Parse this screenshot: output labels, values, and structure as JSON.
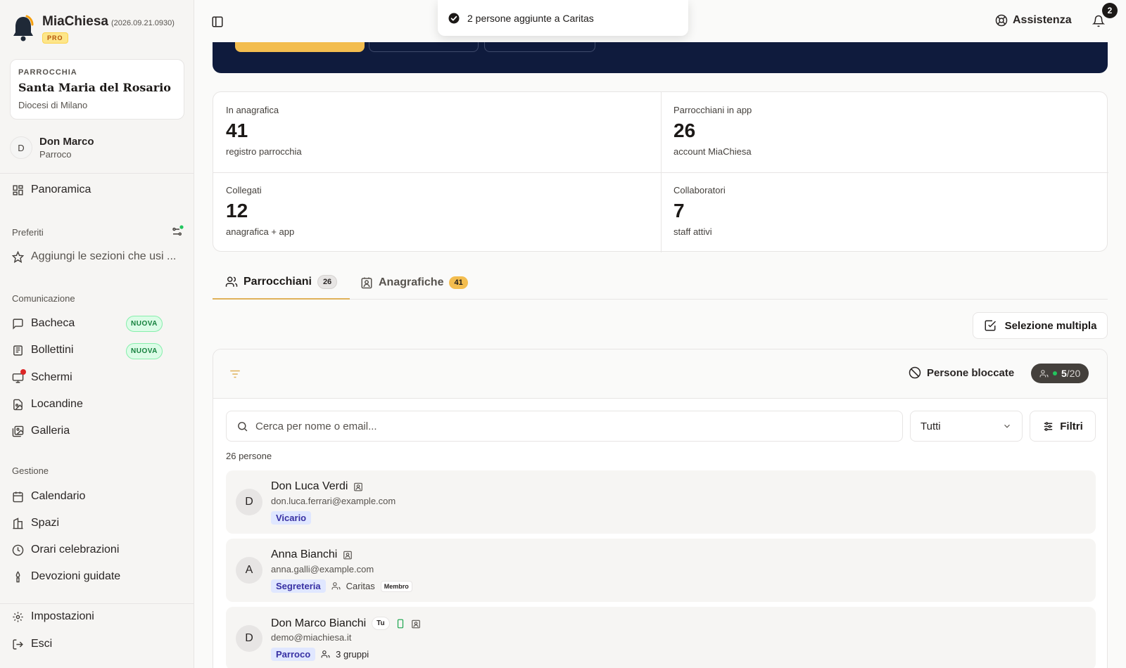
{
  "app": {
    "name": "MiaChiesa",
    "version": "(2026.09.21.0930)",
    "tier": "PRO"
  },
  "parish": {
    "label": "PARROCCHIA",
    "name": "Santa Maria del Rosario",
    "diocese": "Diocesi di Milano"
  },
  "user": {
    "initial": "D",
    "name": "Don Marco",
    "role": "Parroco"
  },
  "sidebar": {
    "overview": "Panoramica",
    "favorites_label": "Preferiti",
    "favorites_hint": "Aggiungi le sezioni che usi ...",
    "communication_label": "Comunicazione",
    "communication": [
      {
        "label": "Bacheca",
        "badge": "NUOVA",
        "icon": "message-square-icon"
      },
      {
        "label": "Bollettini",
        "badge": "NUOVA",
        "icon": "newspaper-icon"
      },
      {
        "label": "Schermi",
        "icon": "monitor-icon",
        "notification_dot": true
      },
      {
        "label": "Locandine",
        "icon": "file-image-icon"
      },
      {
        "label": "Galleria",
        "icon": "gallery-icon"
      }
    ],
    "management_label": "Gestione",
    "management": [
      {
        "label": "Calendario",
        "icon": "calendar-icon"
      },
      {
        "label": "Spazi",
        "icon": "building-icon"
      },
      {
        "label": "Orari celebrazioni",
        "icon": "clock-icon"
      },
      {
        "label": "Devozioni guidate",
        "icon": "candle-icon"
      }
    ],
    "settings": "Impostazioni",
    "logout": "Esci"
  },
  "topbar": {
    "toast": "2 persone aggiunte a Caritas",
    "help": "Assistenza",
    "notifications_count": "2"
  },
  "stats": [
    {
      "label": "In anagrafica",
      "value": "41",
      "sub": "registro parrocchia"
    },
    {
      "label": "Parrocchiani in app",
      "value": "26",
      "sub": "account MiaChiesa"
    },
    {
      "label": "Collegati",
      "value": "12",
      "sub": "anagrafica + app"
    },
    {
      "label": "Collaboratori",
      "value": "7",
      "sub": "staff attivi"
    }
  ],
  "tabs": [
    {
      "label": "Parrocchiani",
      "count": "26",
      "active": true
    },
    {
      "label": "Anagrafiche",
      "count": "41",
      "active": false
    }
  ],
  "multi_select": "Selezione multipla",
  "panel": {
    "blocked_label": "Persone bloccate",
    "quota_used": "5",
    "quota_total": "/20",
    "search_placeholder": "Cerca per nome o email...",
    "filter_select": "Tutti",
    "filters_label": "Filtri",
    "count_text": "26 persone"
  },
  "people": [
    {
      "initial": "D",
      "name": "Don Luca Verdi",
      "email": "don.luca.ferrari@example.com",
      "role": "Vicario"
    },
    {
      "initial": "A",
      "name": "Anna Bianchi",
      "email": "anna.galli@example.com",
      "role": "Segreteria",
      "group": "Caritas",
      "group_role": "Membro"
    },
    {
      "initial": "D",
      "name": "Don Marco Bianchi",
      "you_badge": "Tu",
      "email": "demo@miachiesa.it",
      "role": "Parroco",
      "groups": "3 gruppi"
    }
  ],
  "colors": {
    "accent": "#e0b15a",
    "hero": "#0f1b3d",
    "success": "#22c55e",
    "role_tag": "#e0e7ff"
  }
}
